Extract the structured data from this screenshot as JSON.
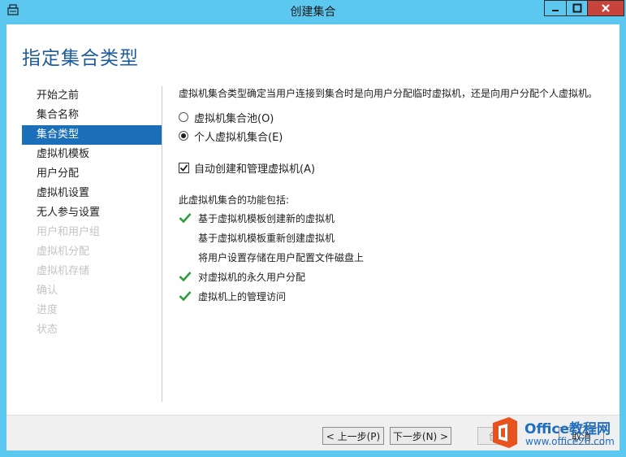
{
  "window": {
    "title": "创建集合",
    "icons": {
      "app": "server-manager-icon",
      "minimize": "minimize-icon",
      "maximize": "maximize-icon",
      "close": "close-icon"
    }
  },
  "page_title": "指定集合类型",
  "nav": {
    "items": [
      {
        "label": "开始之前",
        "state": "normal"
      },
      {
        "label": "集合名称",
        "state": "normal"
      },
      {
        "label": "集合类型",
        "state": "active"
      },
      {
        "label": "虚拟机模板",
        "state": "normal"
      },
      {
        "label": "用户分配",
        "state": "normal"
      },
      {
        "label": "虚拟机设置",
        "state": "normal"
      },
      {
        "label": "无人参与设置",
        "state": "normal"
      },
      {
        "label": "用户和用户组",
        "state": "disabled"
      },
      {
        "label": "虚拟机分配",
        "state": "disabled"
      },
      {
        "label": "虚拟机存储",
        "state": "disabled"
      },
      {
        "label": "确认",
        "state": "disabled"
      },
      {
        "label": "进度",
        "state": "disabled"
      },
      {
        "label": "状态",
        "state": "disabled"
      }
    ]
  },
  "content": {
    "description": "虚拟机集合类型确定当用户连接到集合时是向用户分配临时虚拟机，还是向用户分配个人虚拟机。",
    "options": [
      {
        "label": "虚拟机集合池(O)",
        "selected": false
      },
      {
        "label": "个人虚拟机集合(E)",
        "selected": true
      }
    ],
    "auto_create": {
      "label": "自动创建和管理虚拟机(A)",
      "checked": true
    },
    "features_title": "此虚拟机集合的功能包括:",
    "features": [
      {
        "label": "基于虚拟机模板创建新的虚拟机",
        "supported": true
      },
      {
        "label": "基于虚拟机模板重新创建虚拟机",
        "supported": false
      },
      {
        "label": "将用户设置存储在用户配置文件磁盘上",
        "supported": false
      },
      {
        "label": "对虚拟机的永久用户分配",
        "supported": true
      },
      {
        "label": "虚拟机上的管理访问",
        "supported": true
      }
    ]
  },
  "buttons": {
    "prev": "< 上一步(P)",
    "next": "下一步(N) >",
    "create": "创",
    "cancel": "取消"
  },
  "watermark": {
    "brand": "Office教程网",
    "url": "www.office26.com"
  },
  "colors": {
    "titlebar": "#5cc8f0",
    "page_title": "#1e5c9e",
    "nav_active": "#1b6fb8",
    "check_green": "#2e9e3a",
    "close_button": "#c7443c",
    "watermark_orange": "#e8521e"
  }
}
